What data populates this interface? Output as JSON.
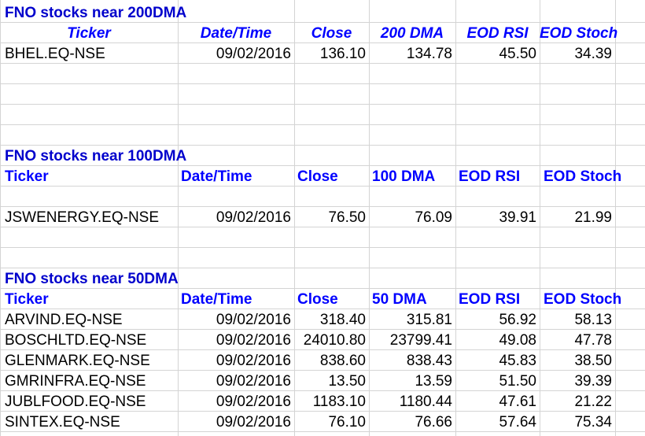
{
  "sections": [
    {
      "title": "FNO stocks near 200DMA",
      "headers": [
        "Ticker",
        "Date/Time",
        "Close",
        "200 DMA",
        "EOD RSI",
        "EOD Stoch"
      ],
      "rows": [
        [
          "BHEL.EQ-NSE",
          "09/02/2016",
          "136.10",
          "134.78",
          "45.50",
          "34.39"
        ]
      ]
    },
    {
      "title": "FNO stocks near 100DMA",
      "headers": [
        "Ticker",
        "Date/Time",
        "Close",
        "100 DMA",
        "EOD RSI",
        "EOD Stoch"
      ],
      "rows": [
        [
          "JSWENERGY.EQ-NSE",
          "09/02/2016",
          "76.50",
          "76.09",
          "39.91",
          "21.99"
        ]
      ]
    },
    {
      "title": "FNO stocks near 50DMA",
      "headers": [
        "Ticker",
        "Date/Time",
        "Close",
        "50 DMA",
        "EOD RSI",
        "EOD Stoch"
      ],
      "rows": [
        [
          "ARVIND.EQ-NSE",
          "09/02/2016",
          "318.40",
          "315.81",
          "56.92",
          "58.13"
        ],
        [
          "BOSCHLTD.EQ-NSE",
          "09/02/2016",
          "24010.80",
          "23799.41",
          "49.08",
          "47.78"
        ],
        [
          "GLENMARK.EQ-NSE",
          "09/02/2016",
          "838.60",
          "838.43",
          "45.83",
          "38.50"
        ],
        [
          "GMRINFRA.EQ-NSE",
          "09/02/2016",
          "13.50",
          "13.59",
          "51.50",
          "39.39"
        ],
        [
          "JUBLFOOD.EQ-NSE",
          "09/02/2016",
          "1183.10",
          "1180.44",
          "47.61",
          "21.22"
        ],
        [
          "SINTEX.EQ-NSE",
          "09/02/2016",
          "76.10",
          "76.66",
          "57.64",
          "75.34"
        ]
      ]
    }
  ],
  "colors": {
    "header_blue": "#0000ff",
    "title_blue": "#0000cc",
    "grid": "#d4d4d4"
  }
}
